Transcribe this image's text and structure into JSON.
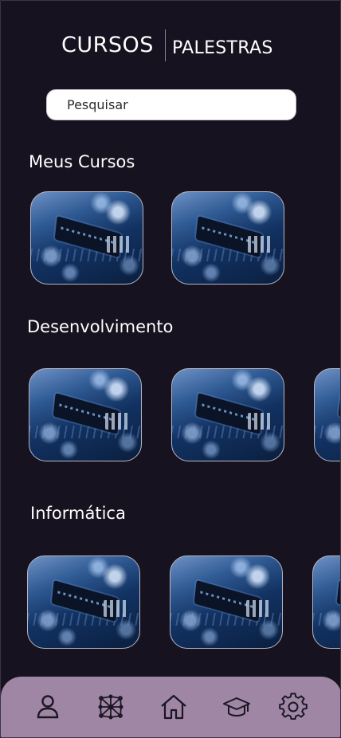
{
  "header": {
    "tab_cursos": "CURSOS",
    "tab_palestras": "PALESTRAS"
  },
  "search": {
    "placeholder": "Pesquisar"
  },
  "sections": [
    {
      "title": "Meus Cursos",
      "course_count_visible": 2
    },
    {
      "title": "Desenvolvimento",
      "course_count_visible": 3
    },
    {
      "title": "Informática",
      "course_count_visible": 3
    }
  ],
  "bottom_nav": {
    "items": [
      {
        "icon": "user-icon"
      },
      {
        "icon": "network-icon"
      },
      {
        "icon": "home-icon"
      },
      {
        "icon": "graduation-cap-icon"
      },
      {
        "icon": "gear-icon"
      }
    ]
  },
  "colors": {
    "background": "#16121f",
    "nav_bar": "#9e86a4",
    "text": "#ffffff",
    "icon": "#1b1622"
  }
}
